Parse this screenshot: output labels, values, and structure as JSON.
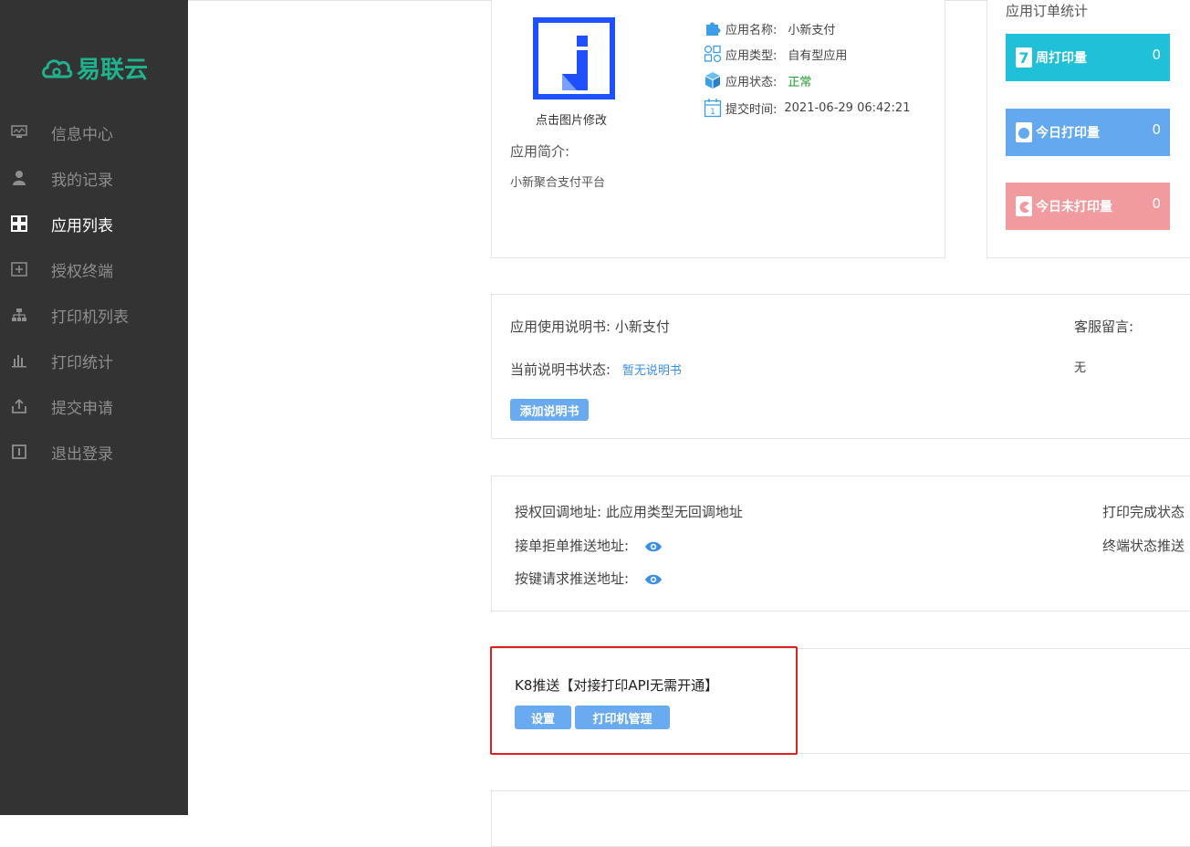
{
  "sidebar": {
    "logo_text": "易联云",
    "brand_color": "#1fb28c",
    "items": [
      {
        "label": "信息中心",
        "icon": "monitor-icon"
      },
      {
        "label": "我的记录",
        "icon": "user-icon"
      },
      {
        "label": "应用列表",
        "icon": "grid-icon",
        "active": true
      },
      {
        "label": "授权终端",
        "icon": "terminal-plus-icon"
      },
      {
        "label": "打印机列表",
        "icon": "network-icon"
      },
      {
        "label": "打印统计",
        "icon": "bar-chart-icon"
      },
      {
        "label": "提交申请",
        "icon": "upload-icon"
      },
      {
        "label": "退出登录",
        "icon": "logout-icon"
      }
    ]
  },
  "app_info": {
    "image_caption": "点击图片修改",
    "name_label": "应用名称:",
    "name_value": "小新支付",
    "type_label": "应用类型:",
    "type_value": "自有型应用",
    "status_label": "应用状态:",
    "status_value": "正常",
    "status_color": "#1a9a2a",
    "time_label": "提交时间:",
    "time_value": "2021-06-29 06:42:21",
    "intro_label": "应用简介:",
    "intro_value": "小新聚合支付平台"
  },
  "order_stats": {
    "title": "应用订单统计",
    "week": {
      "label": "周打印量",
      "value": "0",
      "color": "#1fc0d8"
    },
    "today": {
      "label": "今日打印量",
      "value": "0",
      "color": "#64a8f0"
    },
    "unprinted": {
      "label": "今日未打印量",
      "value": "0",
      "color": "#f29b9f"
    }
  },
  "manual": {
    "label": "应用使用说明书: 小新支付",
    "status_label": "当前说明书状态:",
    "status_value": "暂无说明书",
    "add_button": "添加说明书",
    "service_label": "客服留言:",
    "service_value": "无"
  },
  "callbacks": {
    "auth_callback": "授权回调地址:  此应用类型无回调地址",
    "order_push": "接单拒单推送地址:",
    "key_push": "按键请求推送地址:",
    "print_done": "打印完成状态",
    "terminal_push": "终端状态推送"
  },
  "k8": {
    "title": "K8推送【对接打印API无需开通】",
    "settings_button": "设置",
    "printer_button": "打印机管理"
  }
}
